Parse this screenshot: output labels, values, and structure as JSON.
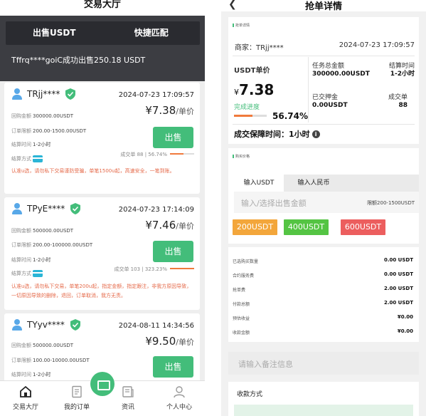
{
  "left": {
    "title": "交易大厅",
    "tabs": [
      "出售USDT",
      "快捷匹配"
    ],
    "ticker": "Tffrq****goiC成功出售250.18 USDT",
    "orders": [
      {
        "user": "TRjj****",
        "time": "2024-07-23 17:09:57",
        "price": "¥7.38",
        "price_unit": "/单价",
        "rows": [
          {
            "k": "回购金额",
            "v": "300000.00USDT"
          },
          {
            "k": "订单限额",
            "v": "200.00-1500.00USDT"
          },
          {
            "k": "结算时间",
            "v": "1-2小时"
          },
          {
            "k": "结算方式",
            "v": ""
          }
        ],
        "sell": "出售",
        "stats": "成交单 88 | 56.74%",
        "progress": 0.5674,
        "note": "认准u选，请勿私下交易谨防受骗，单笔1500u起，高速安全，一笔到账。"
      },
      {
        "user": "TPyE****",
        "time": "2024-07-23 17:14:09",
        "price": "¥7.46",
        "price_unit": "/单价",
        "rows": [
          {
            "k": "回购金额",
            "v": "500000.00USDT"
          },
          {
            "k": "订单限额",
            "v": "200.00-100000.00USDT"
          },
          {
            "k": "结算时间",
            "v": "1-2小时"
          },
          {
            "k": "结算方式",
            "v": ""
          }
        ],
        "sell": "出售",
        "stats": "成交单 103 | 323.23%",
        "progress": 1.0,
        "note": "认准u选，请勿私下交易，单笔200u起，指定金额，指定跟注，非我方原因导致，一切原因导致的删除，退回，订单取消，我方无责。"
      },
      {
        "user": "TYyv****",
        "time": "2024-08-11 14:34:56",
        "price": "¥9.50",
        "price_unit": "/单价",
        "rows": [
          {
            "k": "回购金额",
            "v": "500000.00USDT"
          },
          {
            "k": "订单限额",
            "v": "100.00-10000.00USDT"
          },
          {
            "k": "结算时间",
            "v": "1-2小时"
          }
        ],
        "sell": "出售"
      }
    ],
    "nav": [
      "交易大厅",
      "我的订单",
      "资讯",
      "个人中心"
    ],
    "colors": {
      "accent": "#43bd7a",
      "dark": "#3c3d42",
      "progress": "#f07a3c",
      "warning": "#e56a4a"
    }
  },
  "right": {
    "title": "抢单详情",
    "section1": "抢单详情",
    "merchant": "商家：TRjj****",
    "merchant_time": "2024-07-23 17:09:57",
    "usdt_price_label": "USDT单价",
    "price_symbol": "¥",
    "price": "7.38",
    "progress_label": "完成进度",
    "progress_value": "56.74%",
    "progress": 0.5674,
    "task_total_label": "任务总金额",
    "task_total": "300000.00USDT",
    "settle_time_label": "结算时间",
    "settle_time": "1-2小时",
    "deposit_label": "已交押金",
    "deposit": "0.00USDT",
    "deals_label": "成交单",
    "deals": "88",
    "guarantee": "成交保障时间：1小时",
    "section2": "购买价格",
    "input_tabs": [
      "输入USDT",
      "输入人民币"
    ],
    "input_placeholder": "输入/选择出售金额",
    "limit": "限额200-1500USDT",
    "amounts": [
      {
        "label": "200USDT",
        "color": "#f3a63b"
      },
      {
        "label": "400USDT",
        "color": "#54c443"
      },
      {
        "label": "600USDT",
        "color": "#ec5e5e"
      }
    ],
    "fees": [
      {
        "k": "已选购买数量",
        "v": "0.00 USDT"
      },
      {
        "k": "合约服务费",
        "v": "0.00 USDT"
      },
      {
        "k": "抢单费",
        "v": "2.00 USDT"
      },
      {
        "k": "付款总额",
        "v": "2.00 USDT"
      },
      {
        "k": "预估收益",
        "v": "¥0.00"
      },
      {
        "k": "收款金额",
        "v": "¥0.00"
      }
    ],
    "remark_placeholder": "请输入备注信息",
    "collect_label": "收款方式"
  }
}
